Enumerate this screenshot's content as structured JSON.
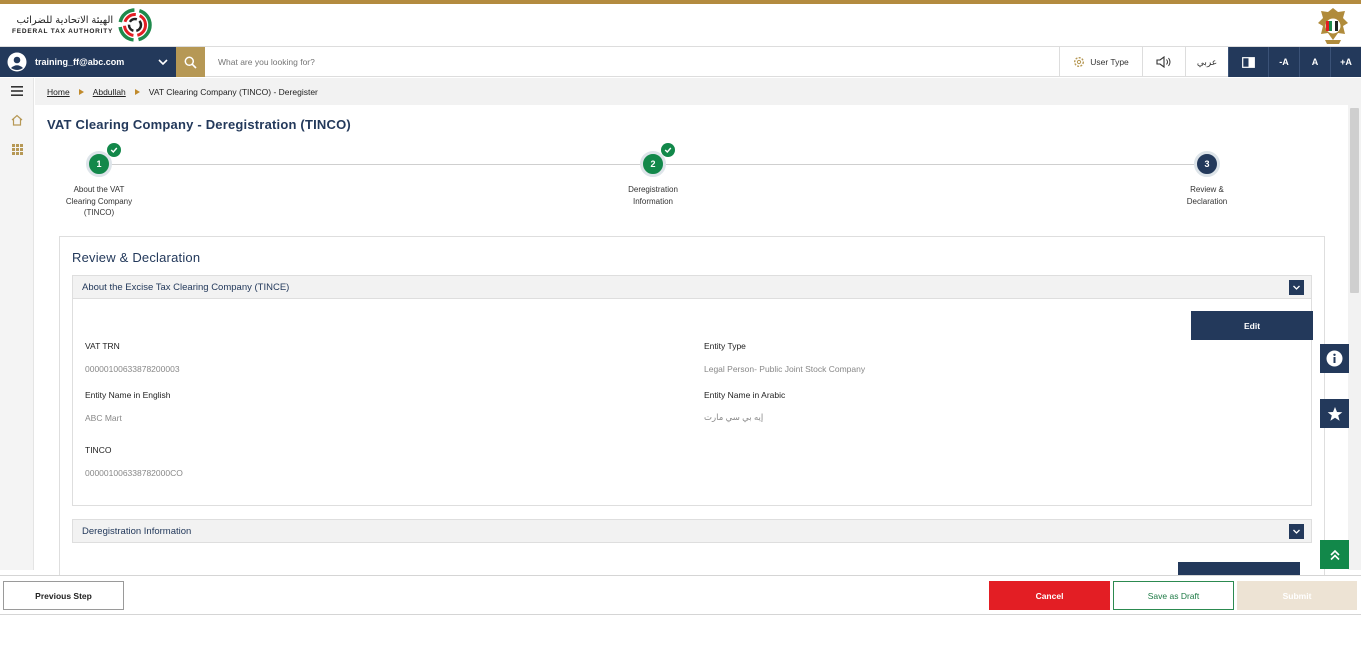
{
  "header": {
    "logo_arabic": "الهيئة الاتحادية للضرائب",
    "logo_english": "FEDERAL TAX AUTHORITY"
  },
  "topnav": {
    "user_email": "training_ff@abc.com",
    "search_placeholder": "What are you looking for?",
    "user_type_label": "User Type",
    "language_label": "عربي",
    "font_decrease": "-A",
    "font_normal": "A",
    "font_increase": "+A"
  },
  "breadcrumb": {
    "home": "Home",
    "level2": "Abdullah",
    "current": "VAT Clearing Company (TINCO) - Deregister"
  },
  "page_title": "VAT Clearing Company - Deregistration (TINCO)",
  "steps": [
    {
      "number": "1",
      "label": "About the VAT Clearing Company (TINCO)",
      "status": "completed"
    },
    {
      "number": "2",
      "label": "Deregistration Information",
      "status": "completed"
    },
    {
      "number": "3",
      "label": "Review & Declaration",
      "status": "active"
    }
  ],
  "review": {
    "title": "Review & Declaration",
    "section1": {
      "header": "About the Excise Tax Clearing Company (TINCE)",
      "edit_label": "Edit",
      "fields": {
        "vat_trn_label": "VAT TRN",
        "vat_trn_value": "00000100633878200003",
        "entity_type_label": "Entity Type",
        "entity_type_value": "Legal Person- Public Joint Stock Company",
        "name_en_label": "Entity Name in English",
        "name_en_value": "ABC Mart",
        "name_ar_label": "Entity Name in Arabic",
        "name_ar_value": "إيه بي سي مارت",
        "tinco_label": "TINCO",
        "tinco_value": "000001006338782000CO"
      }
    },
    "section2": {
      "header": "Deregistration Information"
    }
  },
  "footer": {
    "previous": "Previous Step",
    "cancel": "Cancel",
    "save_draft": "Save as Draft",
    "submit": "Submit"
  },
  "colors": {
    "navy": "#23395b",
    "gold": "#b69855",
    "green": "#12884a",
    "red": "#e31e24"
  }
}
